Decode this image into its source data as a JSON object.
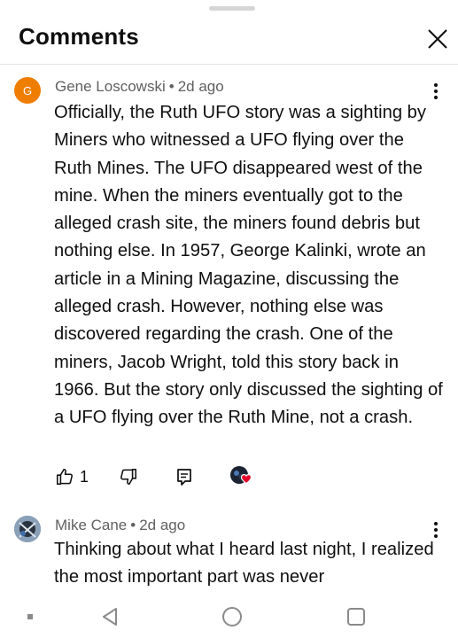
{
  "header": {
    "title": "Comments"
  },
  "comments": [
    {
      "author": "Gene Loscowski",
      "separator": "•",
      "age": "2d ago",
      "avatar_letter": "G",
      "text": "Officially, the Ruth UFO story was a sighting by Miners who witnessed a UFO flying over the Ruth Mines. The UFO disappeared west of the mine. When the miners eventually got to the alleged crash site, the miners found debris but nothing else. In 1957, George Kalinki, wrote an article in a Mining Magazine, discussing the alleged crash. However, nothing else was discovered regarding the crash. One of the miners, Jacob Wright, told this story back in 1966. But the story only discussed the sighting of a UFO flying over the Ruth Mine, not a crash.",
      "like_count": "1"
    },
    {
      "author": "Mike Cane",
      "separator": "•",
      "age": "2d ago",
      "text": "Thinking about what I heard last night, I realized the most important part was never"
    }
  ],
  "colors": {
    "avatar_orange": "#ef7d00",
    "creator_heart": "#e4002b",
    "secondary_text": "#606060"
  },
  "icons": {
    "close": "close-icon",
    "more": "more-vert-icon",
    "like": "thumbs-up-icon",
    "dislike": "thumbs-down-icon",
    "reply": "reply-icon",
    "hearted": "creator-heart-icon",
    "nav_back": "back-triangle-icon",
    "nav_home": "home-circle-icon",
    "nav_recents": "recents-square-icon",
    "nav_menu": "nav-menu-icon"
  }
}
